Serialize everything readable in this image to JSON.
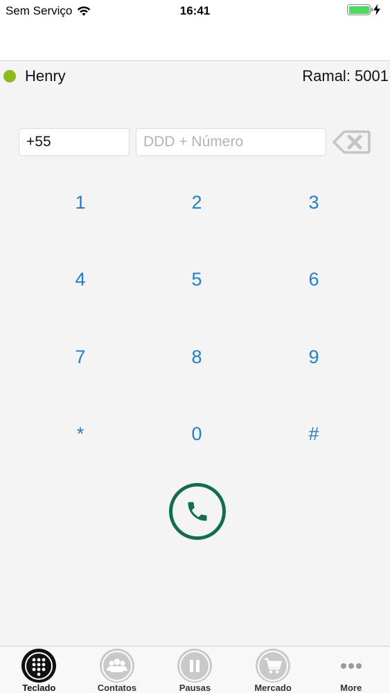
{
  "status_bar": {
    "carrier": "Sem Serviço",
    "time": "16:41",
    "battery_color": "#4cd964"
  },
  "user": {
    "name": "Henry",
    "extension_label": "Ramal: 5001",
    "presence_color": "#8dbb1e"
  },
  "dial": {
    "country_code": "+55",
    "number_placeholder": "DDD + Número",
    "number_value": ""
  },
  "keypad": {
    "keys": [
      "1",
      "2",
      "3",
      "4",
      "5",
      "6",
      "7",
      "8",
      "9",
      "*",
      "0",
      "#"
    ],
    "key_color": "#1e7fd7",
    "call_button_color": "#0f6e4e"
  },
  "tabbar": {
    "tabs": [
      {
        "label": "Teclado",
        "icon": "keypad-icon",
        "active": true
      },
      {
        "label": "Contatos",
        "icon": "contacts-icon",
        "active": false
      },
      {
        "label": "Pausas",
        "icon": "pause-icon",
        "active": false
      },
      {
        "label": "Mercado",
        "icon": "cart-icon",
        "active": false
      },
      {
        "label": "More",
        "icon": "more-icon",
        "active": false
      }
    ]
  }
}
